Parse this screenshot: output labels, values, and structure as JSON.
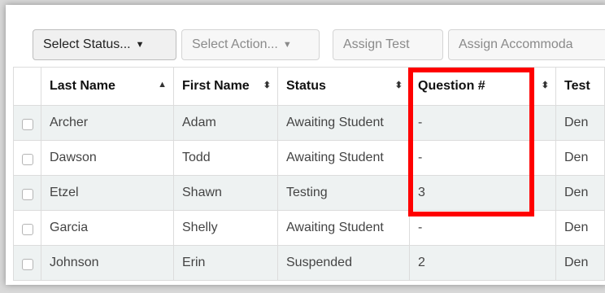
{
  "toolbar": {
    "select_status": "Select Status...",
    "select_action": "Select Action...",
    "assign_test": "Assign Test",
    "assign_accommodations": "Assign Accommoda"
  },
  "table": {
    "headers": {
      "last_name": "Last Name",
      "first_name": "First Name",
      "status": "Status",
      "question": "Question #",
      "test": "Test"
    },
    "rows": [
      {
        "last": "Archer",
        "first": "Adam",
        "status": "Awaiting Student",
        "question": "-",
        "test": "Den"
      },
      {
        "last": "Dawson",
        "first": "Todd",
        "status": "Awaiting Student",
        "question": "-",
        "test": "Den"
      },
      {
        "last": "Etzel",
        "first": "Shawn",
        "status": "Testing",
        "question": "3",
        "test": "Den"
      },
      {
        "last": "Garcia",
        "first": "Shelly",
        "status": "Awaiting Student",
        "question": "-",
        "test": "Den"
      },
      {
        "last": "Johnson",
        "first": "Erin",
        "status": "Suspended",
        "question": "2",
        "test": "Den"
      }
    ]
  },
  "colors": {
    "highlight": "#ff0000",
    "row_stripe": "#eef2f2"
  }
}
